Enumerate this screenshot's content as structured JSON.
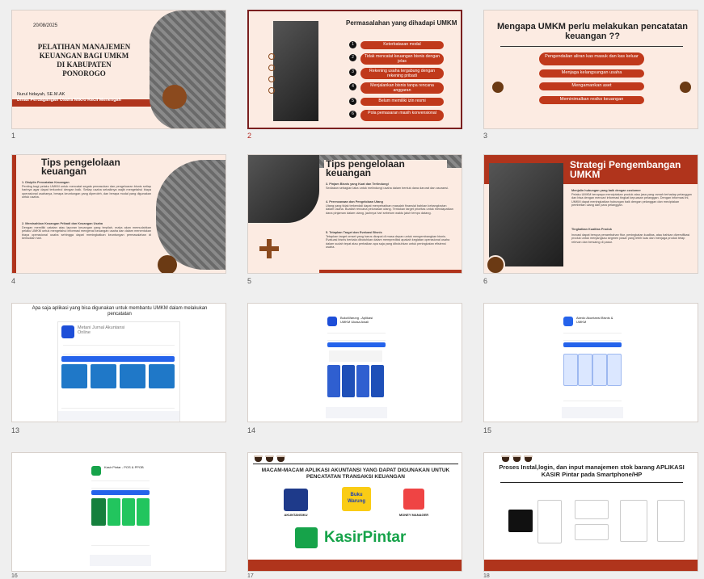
{
  "slides": {
    "s1": {
      "number": "1",
      "date": "20/08/2025",
      "title": "PELATIHAN MANAJEMEN KEUANGAN BAGI UMKM DI KABUPATEN PONOROGO",
      "author": "Nurul hidayah, SE.M.AK",
      "org": "Dinas Perdagangan Usaha Mikro Kecil Menengah"
    },
    "s2": {
      "number": "2",
      "title": "Permasalahan yang dihadapi UMKM",
      "items": [
        {
          "n": "1",
          "label": "Keterbatasan modal"
        },
        {
          "n": "2",
          "label": "Tidak mencatat keuangan bisnis dengan jelas"
        },
        {
          "n": "3",
          "label": "Rekening usaha tergabung dengan rekening pribadi"
        },
        {
          "n": "4",
          "label": "Menjalankan bisnis tanpa rencana anggaran"
        },
        {
          "n": "5",
          "label": "Belum memiliki izin resmi"
        },
        {
          "n": "6",
          "label": "Pola pemasaran masih konvensional"
        }
      ]
    },
    "s3": {
      "number": "3",
      "title": "Mengapa UMKM perlu melakukan pencatatan keuangan ??",
      "items": [
        "Pengendalian aliran kas masuk dan kas keluar",
        "Menjaga kelangsungan usaha",
        "Mengamankan aset",
        "Meminimalkan resiko keuangan"
      ]
    },
    "s4": {
      "number": "4",
      "title": "Tips pengelolaan keuangan",
      "h1": "1. Disiplin Pencatatan Keuangan",
      "p1": "Penting bagi pelaku UMKM untuk mencatat segala pemasukan dan pengeluaran bisnis setiap harinya agar dapat terkontrol dengan baik. Setiap usaha sebaiknya wajib mengetahui biaya operasional usahanya, berapa keuntungan yang diperoleh, dan berapa modal yang digunakan untuk usaha.",
      "h2": "2. Memisahkan Keuangan Pribadi dan Keuangan Usaha",
      "p2": "Dengan memiliki catatan atau laporan keuangan yang terpilah, maka akan memudahkan pelaku UMKM untuk mengetahui informasi mengenai keuangan usaha dan dalam menentukan biaya operasional usaha sehingga dapat meningkatkan keuntungan permasalahan di kemudian hari."
    },
    "s5": {
      "number": "5",
      "title": "Tips pengelolaan keuangan",
      "h3": "3. Pinjam Bisnis yang Kuat dan Terlindungi",
      "p3": "Sediakan sebagian laba untuk melindungi usaha dalam bentuk dana darurat dan asuransi.",
      "h4": "4. Perencanaan dan Pengelolaan Utang",
      "p4": "Utang yang tidak terkendali dapat menyebabkan masalah finansial bahkan kebangkrutan dalam usaha. Buatlah rencana pelunasan utang. Tentukan target prioritas untuk mendapatkan dana pinjaman dalam utang, jauhnya hari sebelum waktu jatuh tempo datang.",
      "h5": "5. Tetapkan Target dan Evaluasi Bisnis",
      "p5": "Tetapkan target omset yang harus dicapai di masa depan untuk mengembangkan bisnis. Evaluasi bisnis berkala dibutuhkan dalam memprediksi apakah kegiatan operasional usaha dalam sudah tepat atau perbaikan apa saja yang dibutuhkan untuk peningkatan efisiensi usaha."
    },
    "s6": {
      "number": "6",
      "title": "Strategi Pengembangan UMKM",
      "h1": "Menjalin hubungan yang baik dengan customer",
      "p1": "Pelaku UMKM berupaya menciptakan produk atau jasa yang ramah terhadap pelanggan dan bisa dengan mencari informasi tingkat kepuasan pelanggan. Dengan informasi ini, UMKM dapat meningkatkan hubungan baik dengan pelanggan dan meciptakan pembelian ulang dari para pelanggan.",
      "h2": "Tingkatkan Kualitas Produk",
      "p2": "Inovasi dapat berupa penambahan fitur, peningkatan kualitas, atau bahkan diversifikasi produk untuk menjangkau segmen pasar yang lebih luas dan menjaga produk tetap relevan dan bersaing di pasar."
    },
    "s13": {
      "number": "13",
      "title": "Apa saja aplikasi yang bisa digunakan untuk membantu UMKM dalam melakukan pencatatan",
      "app": "Metani Jurnal Akuntansi Online"
    },
    "s14": {
      "number": "14",
      "app": "BukuWarung - Aplikasi UMKM Ukasa Awali"
    },
    "s15": {
      "number": "15",
      "app": "Akedo Akuntansi Bisnis & UMKM"
    },
    "s16": {
      "number": "16",
      "app": "Kasir Pintar - POS & PPOB"
    },
    "s17": {
      "number": "17",
      "title": "MACAM-MACAM APLIKASI AKUNTANSI YANG DAPAT DIGUNAKAN UNTUK PENCATATAN TRANSAKSI KEUANGAN",
      "logo1": "AKUNTANSIKU",
      "logo2": "Buku Warung",
      "logo3": "MONEY MANAGER",
      "logo4": "KasirPintar"
    },
    "s18": {
      "number": "18",
      "title": "Proses Instal,login, dan input manajemen stok barang APLIKASI KASIR Pintar pada Smartphone/HP"
    }
  },
  "colors": {
    "accent": "#b0341c",
    "pill": "#c0391b",
    "cream": "#fcebe2",
    "selection": "#7a1f1f"
  }
}
